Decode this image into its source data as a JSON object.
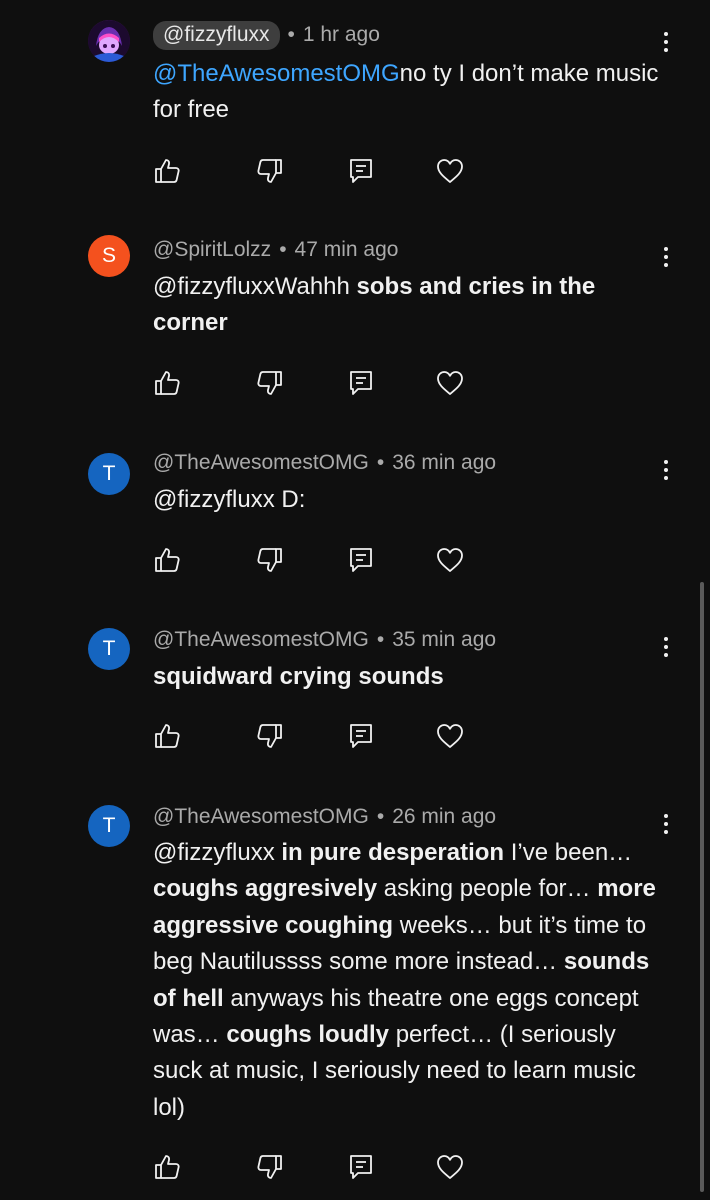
{
  "comments": [
    {
      "avatar_letter": "",
      "avatar_color": "#7b2fbe",
      "handle": "@fizzyfluxx",
      "handle_pill": true,
      "separator": "•",
      "time": "1 hr ago",
      "segments": [
        {
          "text": "@TheAwesomestOMG",
          "style": "mention"
        },
        {
          "text": "no ty I don’t make music for free",
          "style": "normal"
        }
      ]
    },
    {
      "avatar_letter": "S",
      "avatar_color": "#f4511e",
      "handle": "@SpiritLolzz",
      "handle_pill": false,
      "separator": "•",
      "time": "47 min ago",
      "segments": [
        {
          "text": "@fizzyfluxxWahhh ",
          "style": "normal"
        },
        {
          "text": "sobs and cries in the corner",
          "style": "bold"
        }
      ]
    },
    {
      "avatar_letter": "T",
      "avatar_color": "#1565c0",
      "handle": "@TheAwesomestOMG",
      "handle_pill": false,
      "separator": "•",
      "time": "36 min ago",
      "segments": [
        {
          "text": "@fizzyfluxx D:",
          "style": "normal"
        }
      ]
    },
    {
      "avatar_letter": "T",
      "avatar_color": "#1565c0",
      "handle": "@TheAwesomestOMG",
      "handle_pill": false,
      "separator": "•",
      "time": "35 min ago",
      "segments": [
        {
          "text": "squidward crying sounds",
          "style": "bold"
        }
      ]
    },
    {
      "avatar_letter": "T",
      "avatar_color": "#1565c0",
      "handle": "@TheAwesomestOMG",
      "handle_pill": false,
      "separator": "•",
      "time": "26 min ago",
      "segments": [
        {
          "text": "@fizzyfluxx ",
          "style": "normal"
        },
        {
          "text": "in pure desperation",
          "style": "bold"
        },
        {
          "text": " I’ve been… ",
          "style": "normal"
        },
        {
          "text": "coughs aggresively",
          "style": "bold"
        },
        {
          "text": " asking people for… ",
          "style": "normal"
        },
        {
          "text": "more aggressive coughing",
          "style": "bold"
        },
        {
          "text": " weeks… but it’s time to beg Nautilussss some more instead… ",
          "style": "normal"
        },
        {
          "text": "sounds of hell",
          "style": "bold"
        },
        {
          "text": " anyways his theatre one  eggs concept was… ",
          "style": "normal"
        },
        {
          "text": "coughs loudly",
          "style": "bold"
        },
        {
          "text": " perfect… (I seriously suck at music, I seriously need to learn music lol)",
          "style": "normal"
        }
      ]
    }
  ],
  "icons": {
    "like": "thumbs-up-icon",
    "dislike": "thumbs-down-icon",
    "reply": "reply-icon",
    "heart": "heart-icon",
    "menu": "more-vertical-icon"
  },
  "colors": {
    "background": "#0f0f0f",
    "text": "#f1f1f1",
    "meta": "#aaaaaa",
    "mention": "#3ea6ff",
    "handle_pill": "#3e3e3e"
  }
}
